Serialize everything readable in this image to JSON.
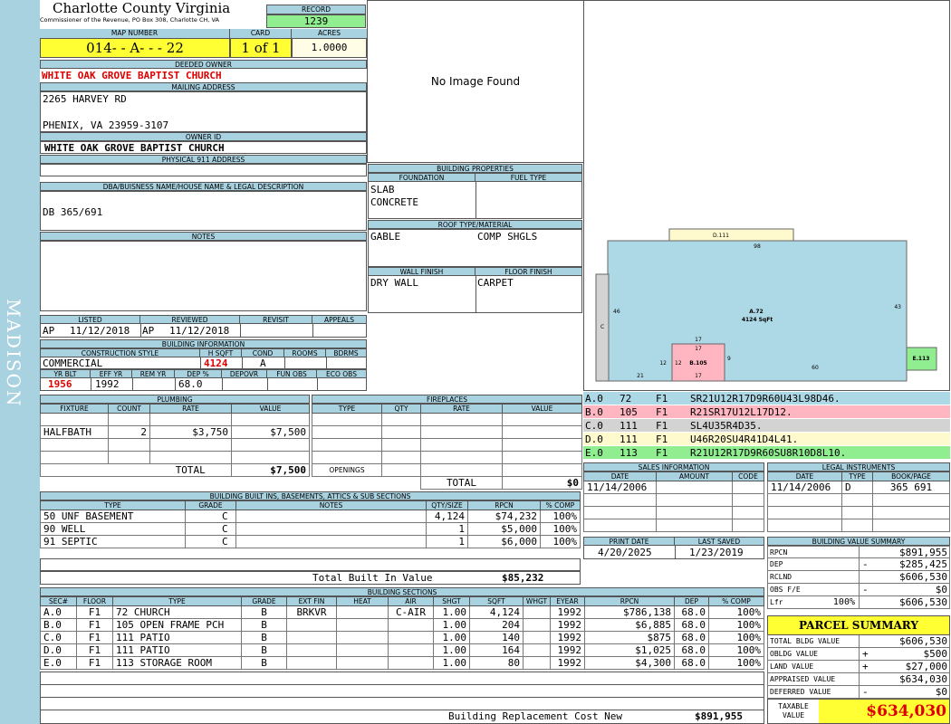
{
  "sidebar": {
    "text": "MADISON"
  },
  "header": {
    "county": "Charlotte County Virginia",
    "commissioner": "Commissioner of the Revenue, PO Box 308, Charlotte CH, VA",
    "record_label": "RECORD",
    "record": "1239",
    "map_label": "MAP NUMBER",
    "map_number": "014- - A- - - 22",
    "card_label": "CARD",
    "card": "1 of 1",
    "acres_label": "ACRES",
    "acres": "1.0000"
  },
  "owner": {
    "deeded_label": "DEEDED OWNER",
    "deeded": "WHITE OAK GROVE BAPTIST CHURCH",
    "mailing_label": "MAILING ADDRESS",
    "mail_line1": "2265 HARVEY RD",
    "mail_line2": "PHENIX, VA 23959-3107",
    "owner_id_label": "OWNER ID",
    "owner_id": "WHITE OAK GROVE BAPTIST CHURCH",
    "physical_label": "PHYSICAL 911 ADDRESS",
    "dba_label": "DBA/BUISNESS NAME/HOUSE NAME & LEGAL DESCRIPTION",
    "dba": "DB 365/691",
    "notes_label": "NOTES"
  },
  "image": {
    "no_image": "No Image Found"
  },
  "building_props": {
    "title": "BUILDING PROPERTIES",
    "foundation_label": "FOUNDATION",
    "fuel_label": "FUEL TYPE",
    "foundation1": "SLAB",
    "foundation2": "CONCRETE",
    "roof_label": "ROOF TYPE/MATERIAL",
    "roof_type": "GABLE",
    "roof_material": "COMP SHGLS",
    "wall_label": "WALL FINISH",
    "floor_label": "FLOOR FINISH",
    "wall": "DRY WALL",
    "floor": "CARPET"
  },
  "listing": {
    "listed_label": "LISTED",
    "reviewed_label": "REVIEWED",
    "revisit_label": "REVISIT",
    "appeals_label": "APPEALS",
    "listed_by": "AP",
    "listed_date": "11/12/2018",
    "reviewed_by": "AP",
    "reviewed_date": "11/12/2018"
  },
  "building_info": {
    "title": "BUILDING INFORMATION",
    "style_label": "CONSTRUCTION STYLE",
    "hsqft_label": "H SQFT",
    "cond_label": "COND",
    "rooms_label": "ROOMS",
    "bdrms_label": "BDRMS",
    "style": "COMMERCIAL",
    "hsqft": "4124",
    "cond": "A",
    "yrblt_label": "YR BLT",
    "effyr_label": "EFF YR",
    "remyr_label": "REM YR",
    "dep_label": "DEP %",
    "depovr_label": "DEPOVR",
    "funobs_label": "FUN OBS",
    "ecoobs_label": "ECO OBS",
    "yrblt": "1956",
    "effyr": "1992",
    "dep": "68.0"
  },
  "plumbing": {
    "title": "PLUMBING",
    "headers": [
      "FIXTURE",
      "COUNT",
      "RATE",
      "VALUE"
    ],
    "rows": [
      {
        "fixture": "HALFBATH",
        "count": "2",
        "rate": "$3,750",
        "value": "$7,500"
      }
    ],
    "total_label": "TOTAL",
    "total": "$7,500"
  },
  "fireplaces": {
    "title": "FIREPLACES",
    "headers": [
      "TYPE",
      "QTY",
      "RATE",
      "VALUE"
    ],
    "openings_label": "OPENINGS",
    "total_label": "TOTAL",
    "total": "$0"
  },
  "sketch": {
    "labels": [
      "D.111",
      "98",
      "46",
      "C",
      "A.72",
      "4124 SqFt",
      "43",
      "17",
      "17",
      "12",
      "12",
      "B.105",
      "9",
      "17",
      "21",
      "60",
      "E.113"
    ],
    "colors": {
      "A": "#add8e6",
      "B": "#ffb6c1",
      "C": "#d3d3d3",
      "D": "#fffacd",
      "E": "#90ee90"
    }
  },
  "sections_legend": [
    {
      "sec": "A.0",
      "code": "72",
      "floor": "F1",
      "vectors": "SR21U12R17D9R60U43L98D46.",
      "color": "#add8e6"
    },
    {
      "sec": "B.0",
      "code": "105",
      "floor": "F1",
      "vectors": "R21SR17U12L17D12.",
      "color": "#ffb6c1"
    },
    {
      "sec": "C.0",
      "code": "111",
      "floor": "F1",
      "vectors": "SL4U35R4D35.",
      "color": "#d3d3d3"
    },
    {
      "sec": "D.0",
      "code": "111",
      "floor": "F1",
      "vectors": "U46R20SU4R41D4L41.",
      "color": "#fffacd"
    },
    {
      "sec": "E.0",
      "code": "113",
      "floor": "F1",
      "vectors": "R21U12R17D9R60SU8R10D8L10.",
      "color": "#90ee90"
    }
  ],
  "sales": {
    "title": "SALES INFORMATION",
    "headers": [
      "DATE",
      "AMOUNT",
      "CODE"
    ],
    "date": "11/14/2006"
  },
  "legal": {
    "title": "LEGAL INSTRUMENTS",
    "headers": [
      "DATE",
      "TYPE",
      "BOOK/PAGE"
    ],
    "date": "11/14/2006",
    "type": "D",
    "bookpage": "365 691"
  },
  "print": {
    "print_label": "PRINT DATE",
    "saved_label": "LAST SAVED",
    "print_date": "4/20/2025",
    "saved_date": "1/23/2019"
  },
  "value_summary": {
    "title": "BUILDING VALUE SUMMARY",
    "rows": [
      {
        "label": "RPCN",
        "sign": "",
        "value": "$891,955"
      },
      {
        "label": "DEP",
        "sign": "-",
        "value": "$285,425"
      },
      {
        "label": "RCLND",
        "sign": "",
        "value": "$606,530"
      },
      {
        "label": "OBS F/E",
        "sign": "-",
        "value": "$0"
      },
      {
        "label": "Lfr",
        "pct": "100%",
        "sign": "",
        "value": "$606,530"
      }
    ]
  },
  "parcel": {
    "title": "PARCEL SUMMARY",
    "rows": [
      {
        "label": "TOTAL BLDG VALUE",
        "sign": "",
        "value": "$606,530"
      },
      {
        "label": "OBLDG VALUE",
        "sign": "+",
        "value": "$500"
      },
      {
        "label": "LAND VALUE",
        "sign": "+",
        "value": "$27,000"
      },
      {
        "label": "APPRAISED VALUE",
        "sign": "",
        "value": "$634,030"
      },
      {
        "label": "DEFERRED VALUE",
        "sign": "-",
        "value": "$0"
      }
    ],
    "taxable_label1": "TAXABLE",
    "taxable_label2": "VALUE",
    "taxable": "$634,030"
  },
  "built_ins": {
    "title": "BUILDING BUILT INS, BASEMENTS, ATTICS & SUB SECTIONS",
    "headers": [
      "TYPE",
      "GRADE",
      "NOTES",
      "QTY/SIZE",
      "RPCN",
      "% COMP"
    ],
    "rows": [
      {
        "type": "50 UNF BASEMENT",
        "grade": "C",
        "notes": "",
        "qty": "4,124",
        "rpcn": "$74,232",
        "comp": "100%"
      },
      {
        "type": "90 WELL",
        "grade": "C",
        "notes": "",
        "qty": "1",
        "rpcn": "$5,000",
        "comp": "100%"
      },
      {
        "type": "91 SEPTIC",
        "grade": "C",
        "notes": "",
        "qty": "1",
        "rpcn": "$6,000",
        "comp": "100%"
      }
    ],
    "total_label": "Total Built In Value",
    "total": "$85,232"
  },
  "sections": {
    "title": "BUILDING SECTIONS",
    "headers": [
      "SEC#",
      "FLOOR",
      "TYPE",
      "GRADE",
      "EXT FIN",
      "HEAT",
      "AIR",
      "SHGT",
      "SQFT",
      "WHGT",
      "EYEAR",
      "RPCN",
      "DEP",
      "% COMP"
    ],
    "rows": [
      {
        "sec": "A.0",
        "floor": "F1",
        "type": "72 CHURCH",
        "grade": "B",
        "ext": "BRKVR",
        "heat": "",
        "air": "C-AIR",
        "shgt": "1.00",
        "sqft": "4,124",
        "whgt": "",
        "eyear": "1992",
        "rpcn": "$786,138",
        "dep": "68.0",
        "comp": "100%"
      },
      {
        "sec": "B.0",
        "floor": "F1",
        "type": "105 OPEN FRAME PCH",
        "grade": "B",
        "ext": "",
        "heat": "",
        "air": "",
        "shgt": "1.00",
        "sqft": "204",
        "whgt": "",
        "eyear": "1992",
        "rpcn": "$6,885",
        "dep": "68.0",
        "comp": "100%"
      },
      {
        "sec": "C.0",
        "floor": "F1",
        "type": "111 PATIO",
        "grade": "B",
        "ext": "",
        "heat": "",
        "air": "",
        "shgt": "1.00",
        "sqft": "140",
        "whgt": "",
        "eyear": "1992",
        "rpcn": "$875",
        "dep": "68.0",
        "comp": "100%"
      },
      {
        "sec": "D.0",
        "floor": "F1",
        "type": "111 PATIO",
        "grade": "B",
        "ext": "",
        "heat": "",
        "air": "",
        "shgt": "1.00",
        "sqft": "164",
        "whgt": "",
        "eyear": "1992",
        "rpcn": "$1,025",
        "dep": "68.0",
        "comp": "100%"
      },
      {
        "sec": "E.0",
        "floor": "F1",
        "type": "113 STORAGE ROOM",
        "grade": "B",
        "ext": "",
        "heat": "",
        "air": "",
        "shgt": "1.00",
        "sqft": "80",
        "whgt": "",
        "eyear": "1992",
        "rpcn": "$4,300",
        "dep": "68.0",
        "comp": "100%"
      }
    ],
    "total_label": "Building Replacement Cost New",
    "total": "$891,955"
  }
}
